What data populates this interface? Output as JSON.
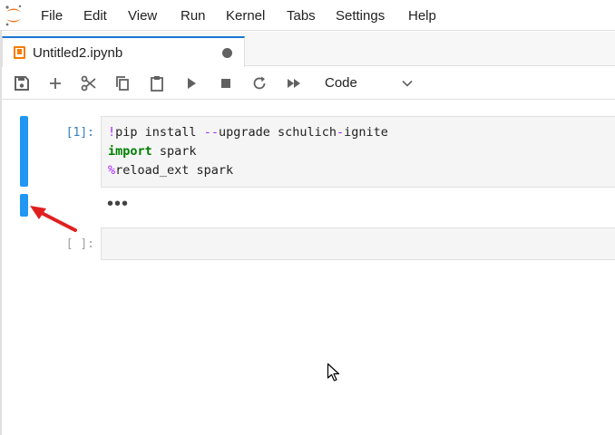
{
  "menubar": {
    "items": [
      "File",
      "Edit",
      "View",
      "Run",
      "Kernel",
      "Tabs",
      "Settings",
      "Help"
    ]
  },
  "tab": {
    "label": "Untitled2.ipynb",
    "icon": "notebook-icon"
  },
  "toolbar": {
    "icons": [
      "save-icon",
      "add-icon",
      "cut-icon",
      "copy-icon",
      "paste-icon",
      "run-icon",
      "stop-icon",
      "restart-icon",
      "fast-forward-icon"
    ],
    "cell_type": "Code"
  },
  "cells": [
    {
      "prompt": "[1]:",
      "lines": [
        [
          {
            "t": "!",
            "c": "magic"
          },
          {
            "t": "pip install ",
            "c": ""
          },
          {
            "t": "--",
            "c": "op"
          },
          {
            "t": "upgrade schulich",
            "c": ""
          },
          {
            "t": "-",
            "c": "op"
          },
          {
            "t": "ignite",
            "c": ""
          }
        ],
        [
          {
            "t": "import",
            "c": "kw"
          },
          {
            "t": " spark",
            "c": ""
          }
        ],
        [
          {
            "t": "%",
            "c": "magic"
          },
          {
            "t": "reload_ext spark",
            "c": ""
          }
        ]
      ],
      "output": "•••"
    },
    {
      "prompt": "[ ]:",
      "lines": []
    }
  ],
  "colors": {
    "accent": "#2196f3",
    "tab_icon": "#f57c00",
    "annotation_arrow": "#e02020"
  }
}
